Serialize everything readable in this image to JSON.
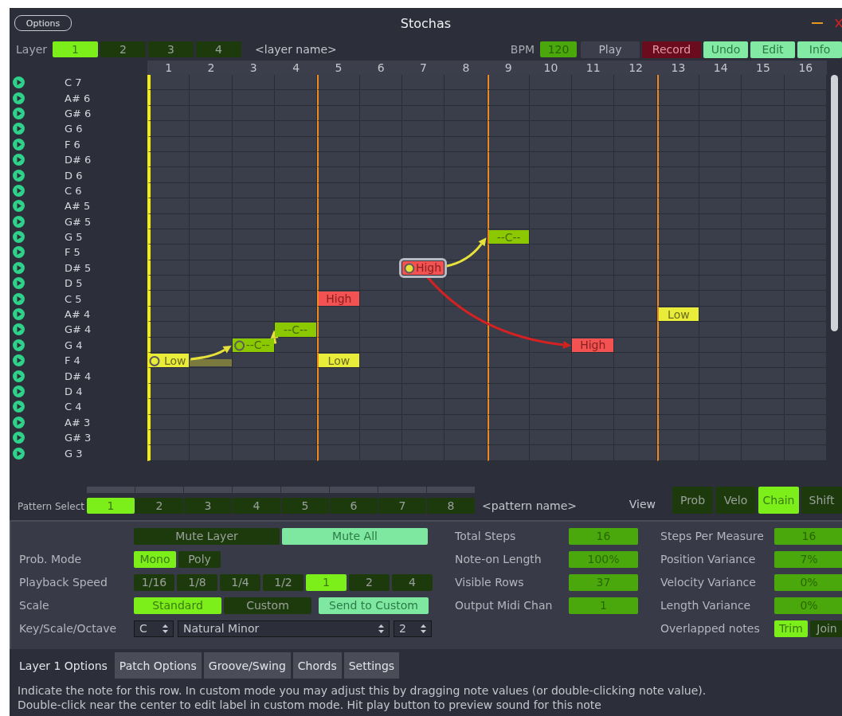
{
  "window": {
    "title": "Stochas",
    "options_button": "Options"
  },
  "layer_bar": {
    "label": "Layer",
    "layers": [
      {
        "label": "1",
        "selected": true
      },
      {
        "label": "2",
        "selected": false
      },
      {
        "label": "3",
        "selected": false
      },
      {
        "label": "4",
        "selected": false
      }
    ],
    "layer_name": "<layer name>",
    "bpm_label": "BPM",
    "bpm": "120",
    "buttons": [
      {
        "label": "Play",
        "kind": "plain"
      },
      {
        "label": "Record",
        "kind": "record"
      },
      {
        "label": "Undo",
        "kind": "light"
      },
      {
        "label": "Edit",
        "kind": "light"
      },
      {
        "label": "Info",
        "kind": "light"
      }
    ]
  },
  "grid": {
    "columns": [
      {
        "label": "1",
        "playhead": true,
        "bar_start": false
      },
      {
        "label": "2",
        "playhead": false,
        "bar_start": false
      },
      {
        "label": "3",
        "playhead": false,
        "bar_start": false
      },
      {
        "label": "4",
        "playhead": false,
        "bar_start": false
      },
      {
        "label": "5",
        "playhead": false,
        "bar_start": true
      },
      {
        "label": "6",
        "playhead": false,
        "bar_start": false
      },
      {
        "label": "7",
        "playhead": false,
        "bar_start": false
      },
      {
        "label": "8",
        "playhead": false,
        "bar_start": false
      },
      {
        "label": "9",
        "playhead": false,
        "bar_start": true
      },
      {
        "label": "10",
        "playhead": false,
        "bar_start": false
      },
      {
        "label": "11",
        "playhead": false,
        "bar_start": false
      },
      {
        "label": "12",
        "playhead": false,
        "bar_start": false
      },
      {
        "label": "13",
        "playhead": false,
        "bar_start": true
      },
      {
        "label": "14",
        "playhead": false,
        "bar_start": false
      },
      {
        "label": "15",
        "playhead": false,
        "bar_start": false
      },
      {
        "label": "16",
        "playhead": false,
        "bar_start": false
      }
    ],
    "rows": [
      {
        "note": "C 7"
      },
      {
        "note": "A# 6"
      },
      {
        "note": "G# 6"
      },
      {
        "note": "G 6"
      },
      {
        "note": "F 6"
      },
      {
        "note": "D# 6"
      },
      {
        "note": "D 6"
      },
      {
        "note": "C 6"
      },
      {
        "note": "A# 5"
      },
      {
        "note": "G# 5"
      },
      {
        "note": "G 5",
        "cells": [
          {
            "kind": "empty"
          },
          {
            "kind": "empty"
          },
          {
            "kind": "empty"
          },
          {
            "kind": "empty"
          },
          {
            "kind": "empty"
          },
          {
            "kind": "empty"
          },
          {
            "kind": "empty"
          },
          {
            "kind": "empty"
          },
          {
            "kind": "chain",
            "label": "--C--",
            "selected": false,
            "handle": false,
            "tail": false,
            "arrow_in": true
          },
          {
            "kind": "empty"
          },
          {
            "kind": "empty"
          },
          {
            "kind": "empty"
          },
          {
            "kind": "empty"
          },
          {
            "kind": "empty"
          },
          {
            "kind": "empty"
          },
          {
            "kind": "empty"
          }
        ]
      },
      {
        "note": "F 5"
      },
      {
        "note": "D# 5",
        "cells": [
          {
            "kind": "empty"
          },
          {
            "kind": "empty"
          },
          {
            "kind": "empty"
          },
          {
            "kind": "empty"
          },
          {
            "kind": "empty"
          },
          {
            "kind": "empty"
          },
          {
            "kind": "high",
            "label": "High",
            "selected": true,
            "handle": true,
            "tail": false,
            "arrow_in": false
          },
          {
            "kind": "empty"
          },
          {
            "kind": "empty"
          },
          {
            "kind": "empty"
          },
          {
            "kind": "empty"
          },
          {
            "kind": "empty"
          },
          {
            "kind": "empty"
          },
          {
            "kind": "empty"
          },
          {
            "kind": "empty"
          },
          {
            "kind": "empty"
          }
        ]
      },
      {
        "note": "D 5"
      },
      {
        "note": "C 5",
        "cells": [
          {
            "kind": "empty"
          },
          {
            "kind": "empty"
          },
          {
            "kind": "empty"
          },
          {
            "kind": "empty"
          },
          {
            "kind": "high",
            "label": "High",
            "selected": false,
            "handle": false,
            "tail": false,
            "arrow_in": false
          },
          {
            "kind": "empty"
          },
          {
            "kind": "empty"
          },
          {
            "kind": "empty"
          },
          {
            "kind": "empty"
          },
          {
            "kind": "empty"
          },
          {
            "kind": "empty"
          },
          {
            "kind": "empty"
          },
          {
            "kind": "empty"
          },
          {
            "kind": "empty"
          },
          {
            "kind": "empty"
          },
          {
            "kind": "empty"
          }
        ]
      },
      {
        "note": "A# 4",
        "cells": [
          {
            "kind": "empty"
          },
          {
            "kind": "empty"
          },
          {
            "kind": "empty"
          },
          {
            "kind": "empty"
          },
          {
            "kind": "empty"
          },
          {
            "kind": "empty"
          },
          {
            "kind": "empty"
          },
          {
            "kind": "empty"
          },
          {
            "kind": "empty"
          },
          {
            "kind": "empty"
          },
          {
            "kind": "empty"
          },
          {
            "kind": "empty"
          },
          {
            "kind": "low",
            "label": "Low",
            "selected": false,
            "handle": false,
            "tail": false,
            "arrow_in": false
          },
          {
            "kind": "empty"
          },
          {
            "kind": "empty"
          },
          {
            "kind": "empty"
          }
        ]
      },
      {
        "note": "G# 4",
        "cells": [
          {
            "kind": "empty"
          },
          {
            "kind": "empty"
          },
          {
            "kind": "empty"
          },
          {
            "kind": "chain",
            "label": "--C--",
            "selected": false,
            "handle": false,
            "tail": false,
            "arrow_in": true
          },
          {
            "kind": "empty"
          },
          {
            "kind": "empty"
          },
          {
            "kind": "empty"
          },
          {
            "kind": "empty"
          },
          {
            "kind": "empty"
          },
          {
            "kind": "empty"
          },
          {
            "kind": "empty"
          },
          {
            "kind": "empty"
          },
          {
            "kind": "empty"
          },
          {
            "kind": "empty"
          },
          {
            "kind": "empty"
          },
          {
            "kind": "empty"
          }
        ]
      },
      {
        "note": "G 4",
        "cells": [
          {
            "kind": "empty"
          },
          {
            "kind": "empty"
          },
          {
            "kind": "chain",
            "label": "--C--",
            "selected": false,
            "handle": true,
            "tail": false,
            "arrow_in": true
          },
          {
            "kind": "empty"
          },
          {
            "kind": "empty"
          },
          {
            "kind": "empty"
          },
          {
            "kind": "empty"
          },
          {
            "kind": "empty"
          },
          {
            "kind": "empty"
          },
          {
            "kind": "empty"
          },
          {
            "kind": "high",
            "label": "High",
            "selected": false,
            "handle": false,
            "tail": false,
            "arrow_in": true
          },
          {
            "kind": "empty"
          },
          {
            "kind": "empty"
          },
          {
            "kind": "empty"
          },
          {
            "kind": "empty"
          },
          {
            "kind": "empty"
          }
        ]
      },
      {
        "note": "F 4",
        "cells": [
          {
            "kind": "low",
            "label": "Low",
            "selected": false,
            "handle": true,
            "tail": true,
            "arrow_in": false
          },
          {
            "kind": "empty"
          },
          {
            "kind": "empty"
          },
          {
            "kind": "empty"
          },
          {
            "kind": "low",
            "label": "Low",
            "selected": false,
            "handle": false,
            "tail": false,
            "arrow_in": false
          },
          {
            "kind": "empty"
          },
          {
            "kind": "empty"
          },
          {
            "kind": "empty"
          },
          {
            "kind": "empty"
          },
          {
            "kind": "empty"
          },
          {
            "kind": "empty"
          },
          {
            "kind": "empty"
          },
          {
            "kind": "empty"
          },
          {
            "kind": "empty"
          },
          {
            "kind": "empty"
          },
          {
            "kind": "empty"
          }
        ]
      },
      {
        "note": "D# 4"
      },
      {
        "note": "D 4"
      },
      {
        "note": "C 4"
      },
      {
        "note": "A# 3"
      },
      {
        "note": "G# 3"
      },
      {
        "note": "G 3"
      }
    ]
  },
  "pattern_bar": {
    "label": "Pattern Select",
    "patterns": [
      {
        "label": "1",
        "selected": true
      },
      {
        "label": "2",
        "selected": false
      },
      {
        "label": "3",
        "selected": false
      },
      {
        "label": "4",
        "selected": false
      },
      {
        "label": "5",
        "selected": false
      },
      {
        "label": "6",
        "selected": false
      },
      {
        "label": "7",
        "selected": false
      },
      {
        "label": "8",
        "selected": false
      }
    ],
    "pattern_name": "<pattern name>",
    "view_label": "View",
    "views": [
      {
        "label": "Prob",
        "selected": false
      },
      {
        "label": "Velo",
        "selected": false
      },
      {
        "label": "Chain",
        "selected": true
      },
      {
        "label": "Shift",
        "selected": false
      }
    ]
  },
  "options": {
    "mute_layer": {
      "label": "Mute Layer",
      "on": false
    },
    "mute_all": {
      "label": "Mute All",
      "on": true
    },
    "prob_mode": {
      "label": "Prob. Mode",
      "choices": [
        {
          "label": "Mono",
          "selected": true
        },
        {
          "label": "Poly",
          "selected": false
        }
      ]
    },
    "playback_speed": {
      "label": "Playback Speed",
      "choices": [
        {
          "label": "1/16",
          "selected": false
        },
        {
          "label": "1/8",
          "selected": false
        },
        {
          "label": "1/4",
          "selected": false
        },
        {
          "label": "1/2",
          "selected": false
        },
        {
          "label": "1",
          "selected": true
        },
        {
          "label": "2",
          "selected": false
        },
        {
          "label": "4",
          "selected": false
        }
      ]
    },
    "scale": {
      "label": "Scale",
      "choices": [
        {
          "label": "Standard",
          "selected": true
        },
        {
          "label": "Custom",
          "selected": false
        }
      ],
      "send_button": "Send to Custom"
    },
    "key_scale_octave": {
      "label": "Key/Scale/Octave",
      "key": "C",
      "scale": "Natural Minor",
      "octave": "2"
    },
    "middle": [
      {
        "label": "Total Steps",
        "value": "16"
      },
      {
        "label": "Note-on Length",
        "value": "100%"
      },
      {
        "label": "Visible Rows",
        "value": "37"
      },
      {
        "label": "Output Midi Chan",
        "value": "1"
      }
    ],
    "right": [
      {
        "label": "Steps Per Measure",
        "value": "16"
      },
      {
        "label": "Position Variance",
        "value": "7%"
      },
      {
        "label": "Velocity Variance",
        "value": "0%"
      },
      {
        "label": "Length Variance",
        "value": "0%"
      }
    ],
    "overlapped": {
      "label": "Overlapped notes",
      "choices": [
        {
          "label": "Trim",
          "selected": true
        },
        {
          "label": "Join",
          "selected": false
        }
      ]
    }
  },
  "tabs": [
    {
      "label": "Layer 1 Options",
      "selected": true
    },
    {
      "label": "Patch Options",
      "selected": false
    },
    {
      "label": "Groove/Swing",
      "selected": false
    },
    {
      "label": "Chords",
      "selected": false
    },
    {
      "label": "Settings",
      "selected": false
    }
  ],
  "help_text": "Indicate the note for this row. In custom mode you may adjust this by dragging note values (or double-clicking note value). Double-click near the center to edit label in custom mode. Hit play button to preview sound for this note"
}
